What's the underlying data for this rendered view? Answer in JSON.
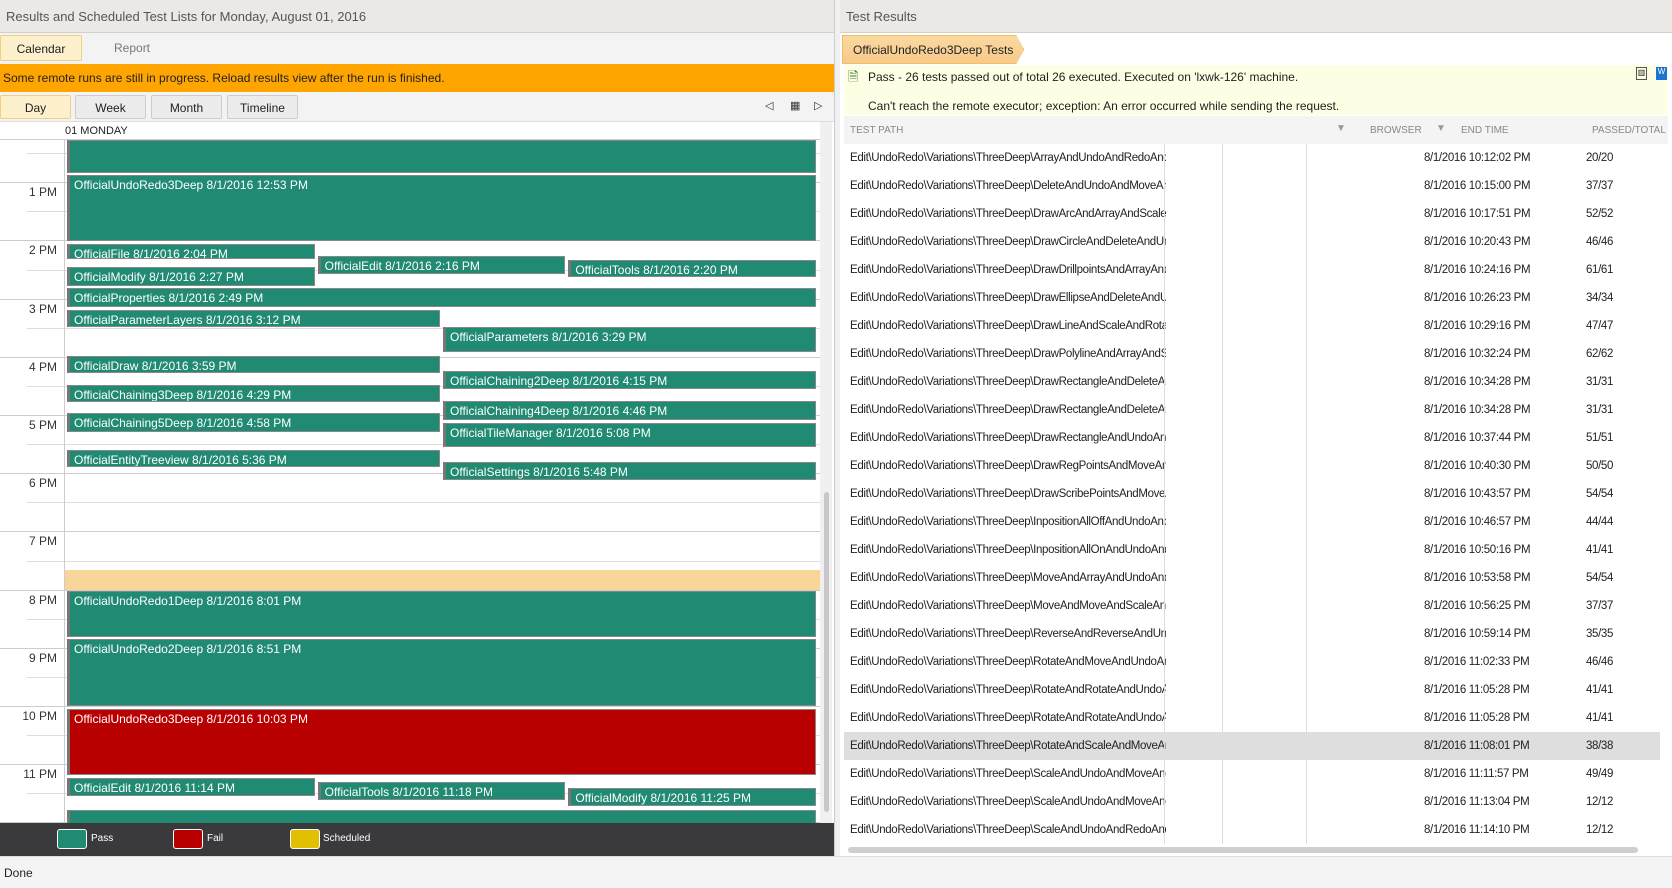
{
  "left": {
    "title": "Results and Scheduled Test Lists for Monday, August 01, 2016",
    "tabs": [
      {
        "label": "Calendar",
        "active": true
      },
      {
        "label": "Report",
        "active": false
      }
    ],
    "banner": "Some remote runs are still in progress. Reload results view after the run is finished.",
    "views": [
      {
        "label": "Day",
        "active": true
      },
      {
        "label": "Week"
      },
      {
        "label": "Month"
      },
      {
        "label": "Timeline"
      }
    ],
    "nav_icons": [
      "triangle-left-icon",
      "calendar-grid-icon",
      "triangle-right-icon"
    ],
    "day_header": "01 MONDAY",
    "hours": [
      "1 PM",
      "2 PM",
      "3 PM",
      "4 PM",
      "5 PM",
      "6 PM",
      "7 PM",
      "8 PM",
      "9 PM",
      "10 PM",
      "11 PM"
    ],
    "colors": {
      "pass": "#208a72",
      "fail": "#b80000",
      "scheduled": "#e0c000",
      "selection": "#f8d69a"
    },
    "events": [
      {
        "label": "",
        "start": "11:40",
        "duration_min": 70,
        "lane": 0,
        "lanes": 1,
        "status": "pass"
      },
      {
        "label": "OfficialUndoRedo3Deep 8/1/2016 12:53 PM",
        "start": "12:53",
        "duration_min": 70,
        "lane": 0,
        "lanes": 1,
        "status": "pass"
      },
      {
        "label": "OfficialFile 8/1/2016 2:04 PM",
        "start": "14:04",
        "duration_min": 17,
        "lane": 0,
        "lanes": 3,
        "status": "pass"
      },
      {
        "label": "OfficialEdit 8/1/2016 2:16 PM",
        "start": "14:16",
        "duration_min": 21,
        "lane": 1,
        "lanes": 3,
        "status": "pass"
      },
      {
        "label": "OfficialTools 8/1/2016 2:20 PM",
        "start": "14:20",
        "duration_min": 20,
        "lane": 2,
        "lanes": 3,
        "status": "pass"
      },
      {
        "label": "OfficialModify 8/1/2016 2:27 PM",
        "start": "14:27",
        "duration_min": 22,
        "lane": 0,
        "lanes": 3,
        "status": "pass"
      },
      {
        "label": "OfficialProperties 8/1/2016 2:49 PM",
        "start": "14:49",
        "duration_min": 22,
        "lane": 0,
        "lanes": 1,
        "status": "pass"
      },
      {
        "label": "OfficialParameterLayers 8/1/2016 3:12 PM",
        "start": "15:12",
        "duration_min": 19,
        "lane": 0,
        "lanes": 2,
        "status": "pass"
      },
      {
        "label": "OfficialParameters 8/1/2016 3:29 PM",
        "start": "15:29",
        "duration_min": 28,
        "lane": 1,
        "lanes": 2,
        "status": "pass"
      },
      {
        "label": "OfficialDraw 8/1/2016 3:59 PM",
        "start": "15:59",
        "duration_min": 20,
        "lane": 0,
        "lanes": 2,
        "status": "pass"
      },
      {
        "label": "OfficialChaining2Deep 8/1/2016 4:15 PM",
        "start": "16:15",
        "duration_min": 20,
        "lane": 1,
        "lanes": 2,
        "status": "pass"
      },
      {
        "label": "OfficialChaining3Deep 8/1/2016 4:29 PM",
        "start": "16:29",
        "duration_min": 20,
        "lane": 0,
        "lanes": 2,
        "status": "pass"
      },
      {
        "label": "OfficialChaining4Deep 8/1/2016 4:46 PM",
        "start": "16:46",
        "duration_min": 21,
        "lane": 1,
        "lanes": 2,
        "status": "pass"
      },
      {
        "label": "OfficialChaining5Deep 8/1/2016 4:58 PM",
        "start": "16:58",
        "duration_min": 22,
        "lane": 0,
        "lanes": 2,
        "status": "pass"
      },
      {
        "label": "OfficialTileManager 8/1/2016 5:08 PM",
        "start": "17:08",
        "duration_min": 27,
        "lane": 1,
        "lanes": 2,
        "status": "pass"
      },
      {
        "label": "OfficialEntityTreeview 8/1/2016 5:36 PM",
        "start": "17:36",
        "duration_min": 20,
        "lane": 0,
        "lanes": 2,
        "status": "pass"
      },
      {
        "label": "OfficialSettings 8/1/2016 5:48 PM",
        "start": "17:48",
        "duration_min": 21,
        "lane": 1,
        "lanes": 2,
        "status": "pass"
      },
      {
        "label": "OfficialUndoRedo1Deep 8/1/2016 8:01 PM",
        "start": "20:01",
        "duration_min": 50,
        "lane": 0,
        "lanes": 1,
        "status": "pass"
      },
      {
        "label": "OfficialUndoRedo2Deep 8/1/2016 8:51 PM",
        "start": "20:51",
        "duration_min": 71,
        "lane": 0,
        "lanes": 1,
        "status": "pass"
      },
      {
        "label": "OfficialUndoRedo3Deep 8/1/2016 10:03 PM",
        "start": "22:03",
        "duration_min": 70,
        "lane": 0,
        "lanes": 1,
        "status": "fail"
      },
      {
        "label": "OfficialEdit 8/1/2016 11:14 PM",
        "start": "23:14",
        "duration_min": 21,
        "lane": 0,
        "lanes": 3,
        "status": "pass"
      },
      {
        "label": "OfficialTools 8/1/2016 11:18 PM",
        "start": "23:18",
        "duration_min": 21,
        "lane": 1,
        "lanes": 3,
        "status": "pass"
      },
      {
        "label": "OfficialModify 8/1/2016 11:25 PM",
        "start": "23:25",
        "duration_min": 20,
        "lane": 2,
        "lanes": 3,
        "status": "pass"
      },
      {
        "label": "",
        "start": "23:47",
        "duration_min": 20,
        "lane": 0,
        "lanes": 1,
        "status": "pass"
      }
    ],
    "selection": {
      "start": "19:40",
      "end": "20:00"
    },
    "legend": [
      {
        "label": "Pass",
        "color": "#208a72"
      },
      {
        "label": "Fail",
        "color": "#b80000"
      },
      {
        "label": "Scheduled",
        "color": "#e0c000"
      }
    ]
  },
  "right": {
    "title": "Test Results",
    "breadcrumb": "OfficialUndoRedo3Deep Tests",
    "summary": "Pass - 26 tests passed out of total 26 executed. Executed on 'lxwk-126' machine.",
    "error": "Can't reach the remote executor; exception: An error occurred while sending the request.",
    "columns": [
      "TEST PATH",
      "BROWSER",
      "END TIME",
      "PASSED/TOTAL"
    ],
    "selected_row": 21,
    "rows": [
      [
        "Edit\\UndoRedo\\Variations\\ThreeDeep\\ArrayAndUndoAndRedoAndRotateAndRotateAndUnd...",
        "",
        "8/1/2016 10:12:02 PM",
        "20/20"
      ],
      [
        "Edit\\UndoRedo\\Variations\\ThreeDeep\\DeleteAndUndoAndMoveAndRotateAndUndo.tstest",
        "",
        "8/1/2016 10:15:00 PM",
        "37/37"
      ],
      [
        "Edit\\UndoRedo\\Variations\\ThreeDeep\\DrawArcAndArrayAndScaleAndUndo.tstest",
        "",
        "8/1/2016 10:17:51 PM",
        "52/52"
      ],
      [
        "Edit\\UndoRedo\\Variations\\ThreeDeep\\DrawCircleAndDeleteAndUndoAndRedoAndDrawCirc...",
        "",
        "8/1/2016 10:20:43 PM",
        "46/46"
      ],
      [
        "Edit\\UndoRedo\\Variations\\ThreeDeep\\DrawDrillpointsAndArrayAndMoveAndUndoAndRedo...",
        "",
        "8/1/2016 10:24:16 PM",
        "61/61"
      ],
      [
        "Edit\\UndoRedo\\Variations\\ThreeDeep\\DrawEllipseAndDeleteAndUndoAndReverse.tstest",
        "",
        "8/1/2016 10:26:23 PM",
        "34/34"
      ],
      [
        "Edit\\UndoRedo\\Variations\\ThreeDeep\\DrawLineAndScaleAndRotateAndUndoAndUndo.tstest",
        "",
        "8/1/2016 10:29:16 PM",
        "47/47"
      ],
      [
        "Edit\\UndoRedo\\Variations\\ThreeDeep\\DrawPolylineAndArrayAndScaleAndUndo.tstest",
        "",
        "8/1/2016 10:32:24 PM",
        "62/62"
      ],
      [
        "Edit\\UndoRedo\\Variations\\ThreeDeep\\DrawRectangleAndDeleteAndUndoAndDelete.tstest",
        "",
        "8/1/2016 10:34:28 PM",
        "31/31"
      ],
      [
        "Edit\\UndoRedo\\Variations\\ThreeDeep\\DrawRectangleAndDeleteAndUndoAndDelete.tstest",
        "",
        "8/1/2016 10:34:28 PM",
        "31/31"
      ],
      [
        "Edit\\UndoRedo\\Variations\\ThreeDeep\\DrawRectangleAndUndoAndRedoAndMoveAndMove...",
        "",
        "8/1/2016 10:37:44 PM",
        "51/51"
      ],
      [
        "Edit\\UndoRedo\\Variations\\ThreeDeep\\DrawRegPointsAndMoveAndMoveAndUndo.tstest",
        "",
        "8/1/2016 10:40:30 PM",
        "50/50"
      ],
      [
        "Edit\\UndoRedo\\Variations\\ThreeDeep\\DrawScribePointsAndMoveAndDeleteAndUndoAndU...",
        "",
        "8/1/2016 10:43:57 PM",
        "54/54"
      ],
      [
        "Edit\\UndoRedo\\Variations\\ThreeDeep\\InpositionAllOffAndUndoAndScaleAndArrayAndUnd...",
        "",
        "8/1/2016 10:46:57 PM",
        "44/44"
      ],
      [
        "Edit\\UndoRedo\\Variations\\ThreeDeep\\InpositionAllOnAndUndoAndRedoDeleteAndUndoAn...",
        "",
        "8/1/2016 10:50:16 PM",
        "41/41"
      ],
      [
        "Edit\\UndoRedo\\Variations\\ThreeDeep\\MoveAndArrayAndUndoAndRedoAndScaleAndUndo....",
        "",
        "8/1/2016 10:53:58 PM",
        "54/54"
      ],
      [
        "Edit\\UndoRedo\\Variations\\ThreeDeep\\MoveAndMoveAndScaleAndUndo.tstest",
        "",
        "8/1/2016 10:56:25 PM",
        "37/37"
      ],
      [
        "Edit\\UndoRedo\\Variations\\ThreeDeep\\ReverseAndReverseAndUndoAndRedoAndArray.tstest",
        "",
        "8/1/2016 10:59:14 PM",
        "35/35"
      ],
      [
        "Edit\\UndoRedo\\Variations\\ThreeDeep\\RotateAndMoveAndUndoAndScaleAndUndoAndRed...",
        "",
        "8/1/2016 11:02:33 PM",
        "46/46"
      ],
      [
        "Edit\\UndoRedo\\Variations\\ThreeDeep\\RotateAndRotateAndUndoAndRotateAndUndo.tstest",
        "",
        "8/1/2016 11:05:28 PM",
        "41/41"
      ],
      [
        "Edit\\UndoRedo\\Variations\\ThreeDeep\\RotateAndRotateAndUndoAndRotateAndUndo.tstest",
        "",
        "8/1/2016 11:05:28 PM",
        "41/41"
      ],
      [
        "Edit\\UndoRedo\\Variations\\ThreeDeep\\RotateAndScaleAndMoveAndUndo.tstest",
        "",
        "8/1/2016 11:08:01 PM",
        "38/38"
      ],
      [
        "Edit\\UndoRedo\\Variations\\ThreeDeep\\ScaleAndUndoAndMoveAndUndoAndMoveAndUndo...",
        "",
        "8/1/2016 11:11:57 PM",
        "49/49"
      ],
      [
        "Edit\\UndoRedo\\Variations\\ThreeDeep\\ScaleAndUndoAndMoveAndUndoAndRedoAndRotat...",
        "",
        "8/1/2016 11:13:04 PM",
        "12/12"
      ],
      [
        "Edit\\UndoRedo\\Variations\\ThreeDeep\\ScaleAndUndoAndRedoAndArrayAndMoveAndUndo....",
        "",
        "8/1/2016 11:14:10 PM",
        "12/12"
      ]
    ]
  },
  "status": "Done"
}
